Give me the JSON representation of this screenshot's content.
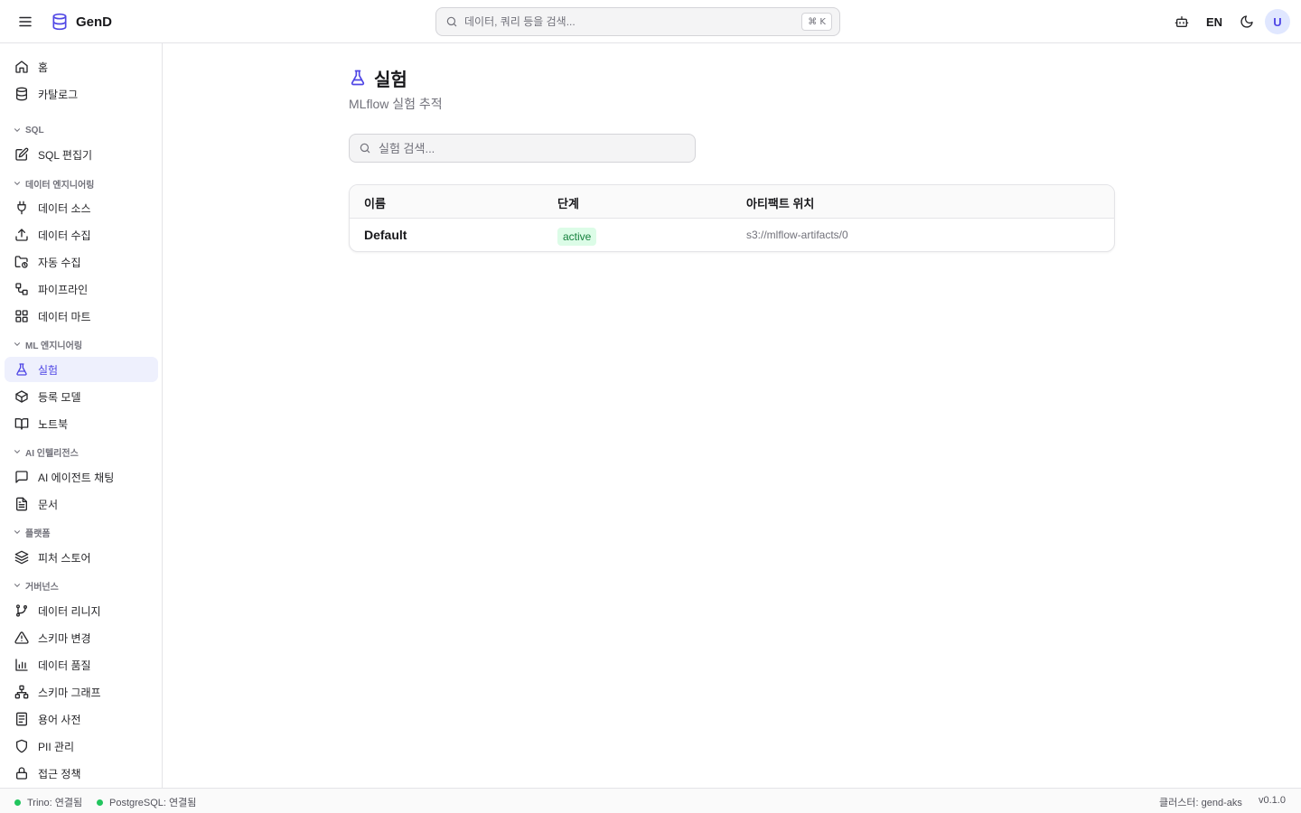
{
  "app": {
    "name": "GenD"
  },
  "header": {
    "search_placeholder": "데이터, 쿼리 등을 검색...",
    "shortcut": "⌘ K",
    "language": "EN",
    "avatar_initial": "U"
  },
  "sidebar": {
    "top_items": [
      {
        "label": "홈",
        "icon": "home-icon"
      },
      {
        "label": "카탈로그",
        "icon": "database-icon"
      }
    ],
    "sections": [
      {
        "title": "SQL",
        "items": [
          {
            "label": "SQL 편집기",
            "icon": "edit-icon"
          }
        ]
      },
      {
        "title": "데이터 엔지니어링",
        "items": [
          {
            "label": "데이터 소스",
            "icon": "plug-icon"
          },
          {
            "label": "데이터 수집",
            "icon": "upload-icon"
          },
          {
            "label": "자동 수집",
            "icon": "folder-sync-icon"
          },
          {
            "label": "파이프라인",
            "icon": "workflow-icon"
          },
          {
            "label": "데이터 마트",
            "icon": "grid-icon"
          }
        ]
      },
      {
        "title": "ML 엔지니어링",
        "items": [
          {
            "label": "실험",
            "icon": "flask-icon",
            "active": true
          },
          {
            "label": "등록 모델",
            "icon": "box-icon"
          },
          {
            "label": "노트북",
            "icon": "book-icon"
          }
        ]
      },
      {
        "title": "AI 인텔리전스",
        "items": [
          {
            "label": "AI 에이전트 채팅",
            "icon": "chat-icon"
          },
          {
            "label": "문서",
            "icon": "document-icon"
          }
        ]
      },
      {
        "title": "플랫폼",
        "items": [
          {
            "label": "피처 스토어",
            "icon": "layers-icon"
          }
        ]
      },
      {
        "title": "거버넌스",
        "items": [
          {
            "label": "데이터 리니지",
            "icon": "git-branch-icon"
          },
          {
            "label": "스키마 변경",
            "icon": "alert-triangle-icon"
          },
          {
            "label": "데이터 품질",
            "icon": "bar-chart-icon"
          },
          {
            "label": "스키마 그래프",
            "icon": "network-icon"
          },
          {
            "label": "용어 사전",
            "icon": "list-icon"
          },
          {
            "label": "PII 관리",
            "icon": "shield-icon"
          },
          {
            "label": "접근 정책",
            "icon": "lock-icon"
          }
        ]
      }
    ]
  },
  "main": {
    "title": "실험",
    "subtitle": "MLflow 실험 추적",
    "search_placeholder": "실험 검색...",
    "columns": [
      "이름",
      "단계",
      "아티팩트 위치"
    ],
    "rows": [
      {
        "name": "Default",
        "stage": "active",
        "artifact_location": "s3://mlflow-artifacts/0"
      }
    ]
  },
  "statusbar": {
    "trino": "Trino: 연결됨",
    "postgres": "PostgreSQL: 연결됨",
    "cluster": "클러스터: gend-aks",
    "version": "v0.1.0"
  },
  "colors": {
    "accent": "#4f46e5",
    "active_bg": "#eef0fd",
    "status_ok": "#22c55e",
    "badge_bg": "#dcfce7",
    "badge_text": "#15803d"
  }
}
